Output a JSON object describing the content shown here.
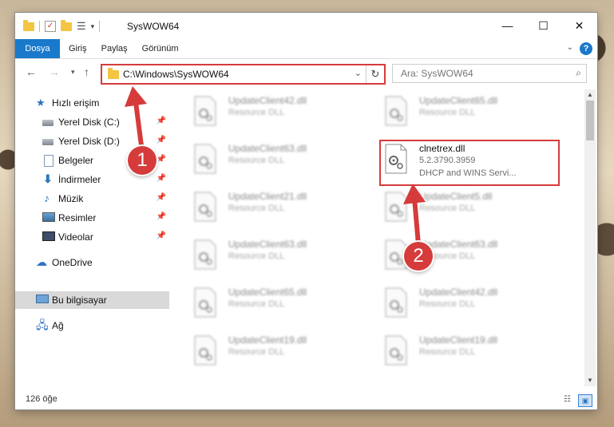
{
  "window": {
    "title": "SysWOW64",
    "controls": {
      "minimize": "—",
      "maximize": "☐",
      "close": "✕"
    }
  },
  "ribbon": {
    "file_tab": "Dosya",
    "tabs": [
      "Giriş",
      "Paylaş",
      "Görünüm"
    ],
    "help": "?"
  },
  "address": {
    "path": "C:\\Windows\\SysWOW64",
    "search_placeholder": "Ara: SysWOW64"
  },
  "nav": {
    "quick_access": "Hızlı erişim",
    "items": [
      {
        "label": "Yerel Disk (C:)",
        "icon": "disk-icon"
      },
      {
        "label": "Yerel Disk (D:)",
        "icon": "disk-icon"
      },
      {
        "label": "Belgeler",
        "icon": "documents-icon"
      },
      {
        "label": "İndirmeler",
        "icon": "downloads-icon"
      },
      {
        "label": "Müzik",
        "icon": "music-icon"
      },
      {
        "label": "Resimler",
        "icon": "pictures-icon"
      },
      {
        "label": "Videolar",
        "icon": "videos-icon"
      }
    ],
    "onedrive": "OneDrive",
    "this_pc": "Bu bilgisayar",
    "network": "Ağ"
  },
  "files": {
    "left": [
      {
        "name": "UpdateClient42.dll",
        "type": "Resource DLL"
      },
      {
        "name": "UpdateClient63.dll",
        "type": "Resource DLL"
      },
      {
        "name": "UpdateClient21.dll",
        "type": "Resource DLL"
      },
      {
        "name": "UpdateClient63.dll",
        "type": "Resource DLL"
      },
      {
        "name": "UpdateClient65.dll",
        "type": "Resource DLL"
      },
      {
        "name": "UpdateClient19.dll",
        "type": "Resource DLL"
      }
    ],
    "right": [
      {
        "name": "UpdateClient65.dll",
        "type": "Resource DLL"
      },
      {
        "name": "UpdateClient5.dll",
        "type": "Resource DLL"
      },
      {
        "name": "UpdateClient63.dll",
        "type": "Resource DLL"
      },
      {
        "name": "UpdateClient42.dll",
        "type": "Resource DLL"
      },
      {
        "name": "UpdateClient19.dll",
        "type": "Resource DLL"
      }
    ],
    "highlighted": {
      "name": "clnetrex.dll",
      "version": "5.2.3790.3959",
      "description": "DHCP and WINS Servi..."
    }
  },
  "status": {
    "count": "126 öğe"
  },
  "annotations": {
    "step1": "1",
    "step2": "2",
    "color": "#d63b3b"
  }
}
